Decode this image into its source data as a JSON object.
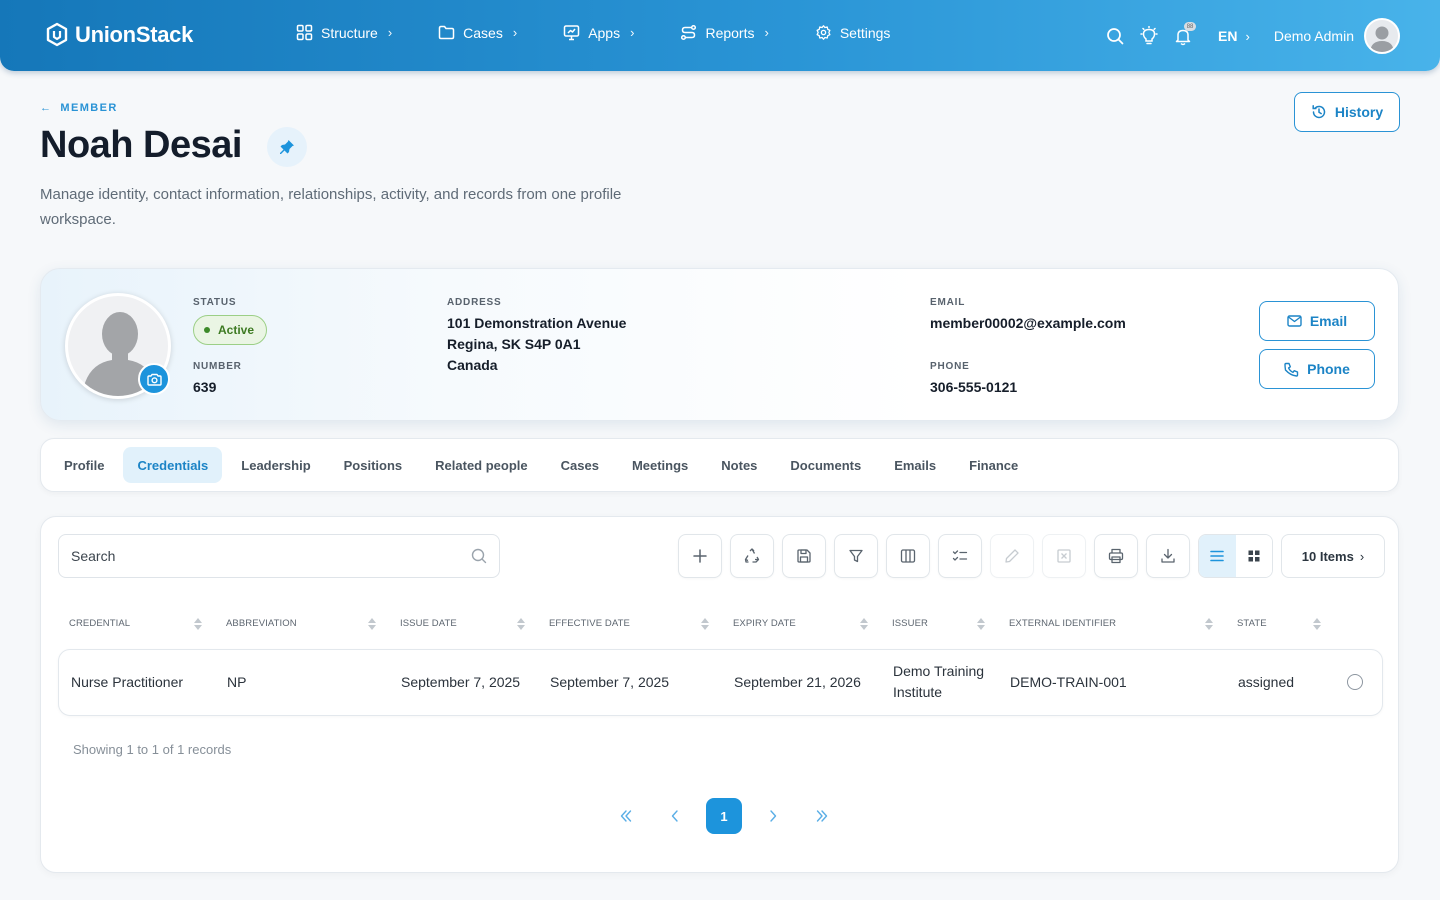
{
  "app": {
    "brand": "UnionStack",
    "nav": [
      {
        "label": "Structure",
        "icon": "grid-icon"
      },
      {
        "label": "Cases",
        "icon": "folder-icon"
      },
      {
        "label": "Apps",
        "icon": "monitor-icon"
      },
      {
        "label": "Reports",
        "icon": "route-icon"
      },
      {
        "label": "Settings",
        "icon": "gear-icon"
      }
    ],
    "language": "EN",
    "user_name": "Demo Admin",
    "notification_badge": "88"
  },
  "header": {
    "back_label": "MEMBER",
    "title": "Noah Desai",
    "description": "Manage identity, contact information, relationships, activity, and records from one profile workspace.",
    "history_label": "History"
  },
  "profile": {
    "status_label": "STATUS",
    "status_value": "Active",
    "number_label": "NUMBER",
    "number_value": "639",
    "address_label": "ADDRESS",
    "address_lines": [
      "101 Demonstration Avenue",
      "Regina, SK S4P 0A1",
      "Canada"
    ],
    "email_label": "EMAIL",
    "email_value": "member00002@example.com",
    "phone_label": "PHONE",
    "phone_value": "306-555-0121",
    "email_button": "Email",
    "phone_button": "Phone"
  },
  "tabs": [
    "Profile",
    "Credentials",
    "Leadership",
    "Positions",
    "Related people",
    "Cases",
    "Meetings",
    "Notes",
    "Documents",
    "Emails",
    "Finance"
  ],
  "active_tab": "Credentials",
  "table": {
    "search_placeholder": "Search",
    "toolbar_icons": [
      "plus-icon",
      "recycle-icon",
      "save-icon",
      "filter-icon",
      "columns-icon",
      "checklist-icon",
      "edit-icon",
      "delete-icon",
      "print-icon",
      "download-icon"
    ],
    "disabled_tools": [
      "edit-icon",
      "delete-icon"
    ],
    "items_label": "10 Items",
    "columns": [
      "CREDENTIAL",
      "ABBREVIATION",
      "ISSUE DATE",
      "EFFECTIVE DATE",
      "EXPIRY DATE",
      "ISSUER",
      "EXTERNAL IDENTIFIER",
      "STATE"
    ],
    "rows": [
      {
        "credential": "Nurse Practitioner",
        "abbreviation": "NP",
        "issue_date": "September 7, 2025",
        "effective_date": "September 7, 2025",
        "expiry_date": "September 21, 2026",
        "issuer_line1": "Demo Training",
        "issuer_line2": "Institute",
        "external_identifier": "DEMO-TRAIN-001",
        "state": "assigned"
      }
    ],
    "records_info": "Showing 1 to 1 of 1 records",
    "current_page": "1"
  },
  "colors": {
    "accent": "#1d94dc",
    "topbar_start": "#1577b9",
    "topbar_end": "#48b3ea",
    "status_green": "#3d7a22"
  }
}
